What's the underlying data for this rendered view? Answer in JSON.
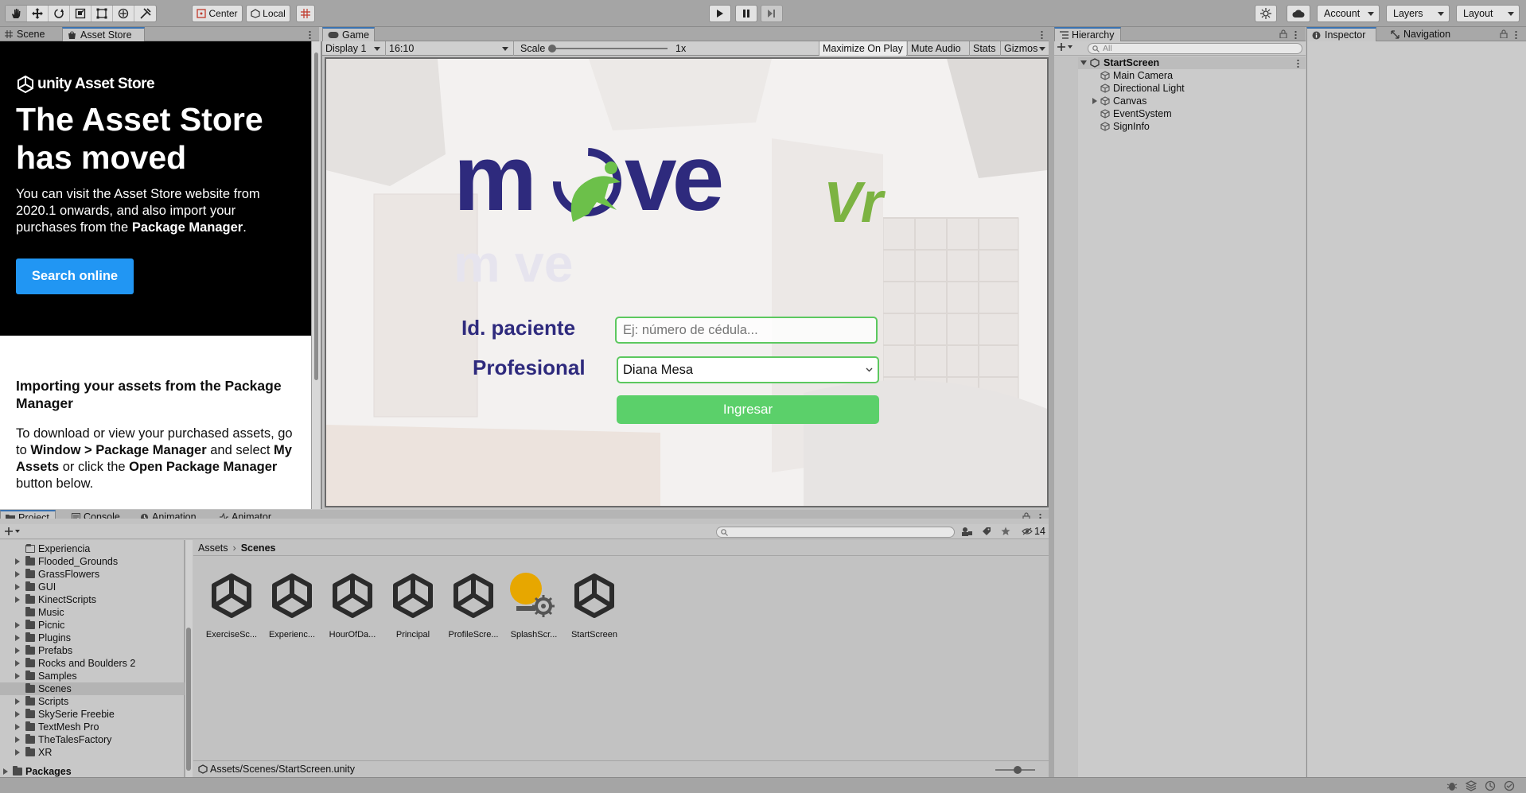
{
  "toolbar": {
    "pivot_center": "Center",
    "pivot_local": "Local",
    "account": "Account",
    "layers": "Layers",
    "layout": "Layout"
  },
  "left_tabs": {
    "scene": "Scene",
    "asset_store": "Asset Store"
  },
  "asset_store": {
    "logo_text": "unity Asset Store",
    "heading_line1": "The Asset Store",
    "heading_line2": "has moved",
    "body_part1": "You can visit the Asset Store website from 2020.1 onwards, and also import your purchases from the ",
    "body_bold": "Package Manager",
    "body_end": ".",
    "button": "Search online",
    "section_heading": "Importing your assets from the Package Manager",
    "section_p1": "To download or view your purchased assets, go to ",
    "section_b1": "Window > Package Manager",
    "section_p2": " and select ",
    "section_b2": "My Assets",
    "section_p3": " or click the ",
    "section_b3": "Open Package Manager",
    "section_p4": " button below."
  },
  "game": {
    "tab": "Game",
    "display": "Display 1",
    "aspect": "16:10",
    "scale_label": "Scale",
    "scale_value": "1x",
    "scale_level": 0.0,
    "maximize": "Maximize On Play",
    "mute": "Mute Audio",
    "stats": "Stats",
    "gizmos": "Gizmos",
    "logo_word": "m ve",
    "logo_vr": "Vr",
    "label_id": "Id. paciente",
    "input_placeholder": "Ej: número de cédula...",
    "label_prof": "Profesional",
    "select_value": "Diana Mesa",
    "login_button": "Ingresar",
    "colors": {
      "navy": "#2e2a7d",
      "green": "#5cc85f",
      "lime": "#7cb342"
    }
  },
  "hierarchy": {
    "tab": "Hierarchy",
    "search_placeholder": "All",
    "scene": "StartScreen",
    "items": [
      "Main Camera",
      "Directional Light",
      "Canvas",
      "EventSystem",
      "SignInfo"
    ]
  },
  "inspector": {
    "tab_inspector": "Inspector",
    "tab_navigation": "Navigation"
  },
  "project": {
    "tabs": [
      "Project",
      "Console",
      "Animation",
      "Animator"
    ],
    "hidden_count": "14",
    "breadcrumb_root": "Assets",
    "breadcrumb_current": "Scenes",
    "folders": [
      "Experiencia",
      "Flooded_Grounds",
      "GrassFlowers",
      "GUI",
      "KinectScripts",
      "Music",
      "Picnic",
      "Plugins",
      "Prefabs",
      "Rocks and Boulders 2",
      "Samples",
      "Scenes",
      "Scripts",
      "SkySerie Freebie",
      "TextMesh Pro",
      "TheTalesFactory",
      "XR"
    ],
    "packages": "Packages",
    "assets": [
      "ExerciseSc...",
      "Experienc...",
      "HourOfDa...",
      "Principal",
      "ProfileScre...",
      "SplashScr...",
      "StartScreen"
    ],
    "path": "Assets/Scenes/StartScreen.unity",
    "zoom_level": 0.55
  }
}
